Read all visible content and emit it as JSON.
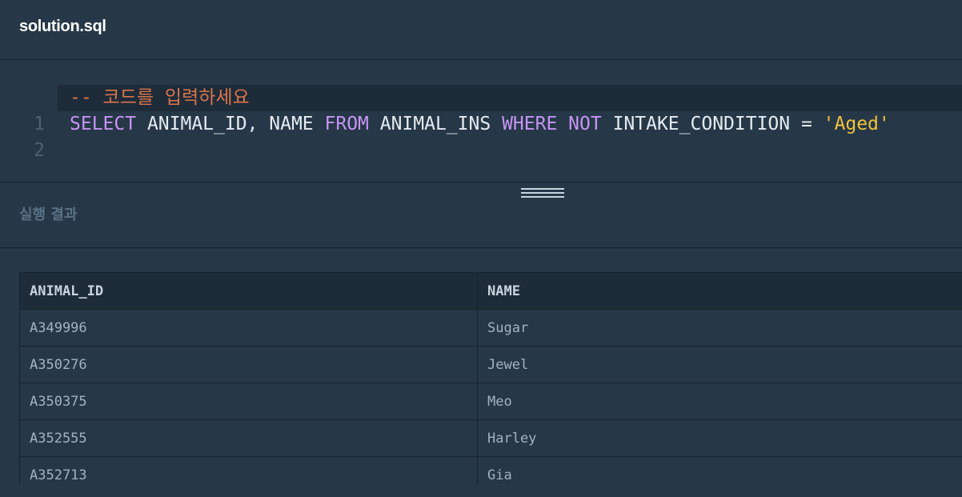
{
  "editor": {
    "file_name": "solution.sql",
    "lines": [
      {
        "number": "1",
        "tokens": [
          {
            "type": "comment",
            "text": "-- 코드를 입력하세요"
          }
        ]
      },
      {
        "number": "2",
        "tokens": [
          {
            "type": "kw",
            "text": "SELECT"
          },
          {
            "type": "plain",
            "text": " ANIMAL_ID, NAME "
          },
          {
            "type": "kw",
            "text": "FROM"
          },
          {
            "type": "plain",
            "text": " ANIMAL_INS "
          },
          {
            "type": "kw",
            "text": "WHERE"
          },
          {
            "type": "plain",
            "text": " "
          },
          {
            "type": "kw",
            "text": "NOT"
          },
          {
            "type": "plain",
            "text": " INTAKE_CONDITION = "
          },
          {
            "type": "str",
            "text": "'Aged'"
          }
        ]
      }
    ]
  },
  "results": {
    "title": "실행 결과",
    "columns": [
      "ANIMAL_ID",
      "NAME"
    ],
    "rows": [
      [
        "A349996",
        "Sugar"
      ],
      [
        "A350276",
        "Jewel"
      ],
      [
        "A350375",
        "Meo"
      ],
      [
        "A352555",
        "Harley"
      ],
      [
        "A352713",
        "Gia"
      ]
    ]
  },
  "colors": {
    "background": "#263747",
    "comment": "#d9764b",
    "keyword": "#c594f2",
    "string": "#f0c23b",
    "plain": "#e5ebf1"
  }
}
